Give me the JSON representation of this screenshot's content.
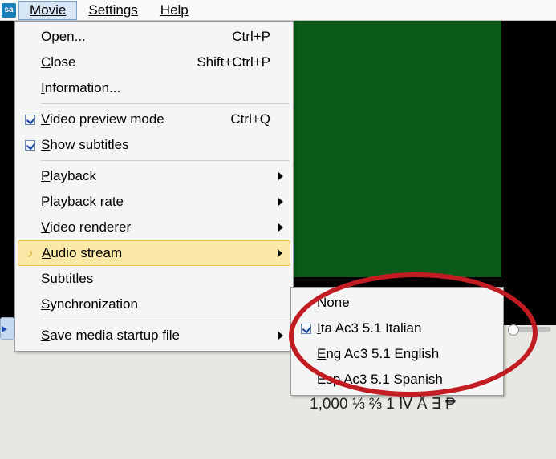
{
  "menubar": {
    "items": [
      "Movie",
      "Settings",
      "Help"
    ],
    "active_index": 0
  },
  "menu": {
    "items": [
      {
        "label": "Open...",
        "accel": "O",
        "shortcut": "Ctrl+P"
      },
      {
        "label": "Close",
        "accel": "C",
        "shortcut": "Shift+Ctrl+P"
      },
      {
        "label": "Information...",
        "accel": "I"
      },
      {
        "sep": true
      },
      {
        "label": "Video preview mode",
        "accel": "V",
        "shortcut": "Ctrl+Q",
        "checked": true
      },
      {
        "label": "Show subtitles",
        "accel": "S",
        "checked": true
      },
      {
        "sep": true
      },
      {
        "label": "Playback",
        "accel": "P",
        "submenu": true
      },
      {
        "label": "Playback rate",
        "accel": "P",
        "submenu": true
      },
      {
        "label": "Video renderer",
        "accel": "V",
        "submenu": true
      },
      {
        "label": "Audio stream",
        "accel": "A",
        "submenu": true,
        "highlight": true,
        "icon": "note"
      },
      {
        "label": "Subtitles",
        "accel": "S"
      },
      {
        "label": "Synchronization",
        "accel": "S"
      },
      {
        "sep": true
      },
      {
        "label": "Save media startup file",
        "accel": "S",
        "submenu": true
      }
    ]
  },
  "submenu": {
    "title": "Audio stream",
    "items": [
      {
        "label": "None",
        "accel": "N"
      },
      {
        "label": "Ita Ac3 5.1 Italian",
        "accel": "I",
        "checked": true
      },
      {
        "label": "Eng Ac3 5.1 English",
        "accel": "E"
      },
      {
        "label": "Esp Ac3 5.1 Spanish",
        "accel": "E"
      }
    ]
  },
  "sample_text": "1,000  ⅓ ⅔ 1 Ⅳ Å ∃ ₱"
}
